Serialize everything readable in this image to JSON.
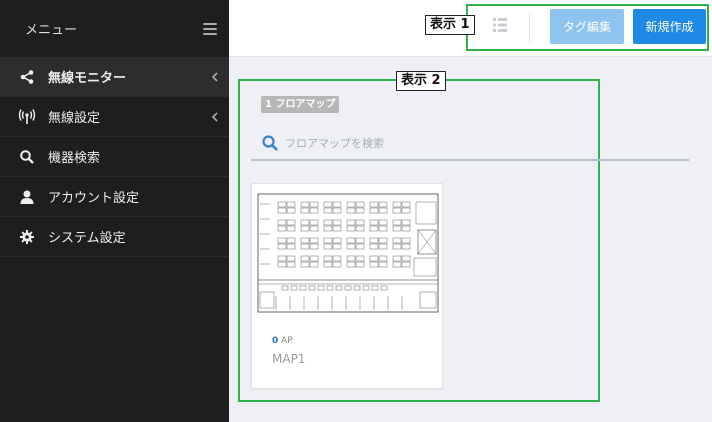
{
  "sidebar": {
    "title": "メニュー",
    "items": [
      {
        "label": "無線モニター",
        "icon": "share-icon",
        "active": true,
        "chevron": true
      },
      {
        "label": "無線設定",
        "icon": "antenna-icon",
        "active": false,
        "chevron": true
      },
      {
        "label": "機器検索",
        "icon": "search-icon",
        "active": false,
        "chevron": false
      },
      {
        "label": "アカウント設定",
        "icon": "user-icon",
        "active": false,
        "chevron": false
      },
      {
        "label": "システム設定",
        "icon": "gear-icon",
        "active": false,
        "chevron": false
      }
    ]
  },
  "annotations": {
    "label1": "表示 1",
    "label2": "表示 2",
    "frame_color": "#2db34a"
  },
  "toolbar": {
    "tag_edit_label": "タグ編集",
    "new_create_label": "新規作成"
  },
  "content": {
    "badge": "1 フロアマップ",
    "search_placeholder": "フロアマップを検索",
    "card": {
      "ap_count": "0",
      "ap_unit": "AP",
      "name": "MAP1"
    }
  },
  "colors": {
    "sidebar_bg": "#1e1e1e",
    "primary": "#1e8ae5",
    "primary_light": "#8fc3ef",
    "accent_blue": "#1e73c2"
  }
}
